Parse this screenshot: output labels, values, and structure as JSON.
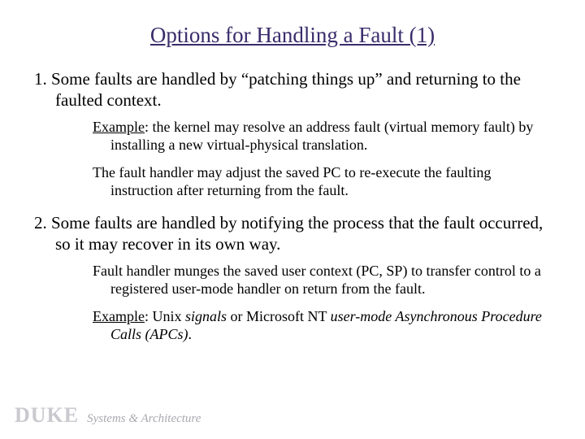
{
  "title": "Options for Handling a Fault (1)",
  "p1": "1. Some faults are handled by “patching things up” and returning to the faulted context.",
  "s1a_label": "Example",
  "s1a_rest": ": the kernel may resolve an address fault (virtual memory fault) by installing a new virtual-physical translation.",
  "s1b": "The fault handler may adjust the saved PC to re-execute the faulting instruction after returning from the fault.",
  "p2": "2. Some faults are handled by notifying the process that the fault occurred, so it may recover in its own way.",
  "s2a": "Fault handler munges the saved user context (PC, SP) to transfer control to a registered user-mode handler on return from the fault.",
  "s2b_label": "Example",
  "s2b_pre": ": Unix ",
  "s2b_sig": "signals",
  "s2b_mid": " or Microsoft NT ",
  "s2b_apc": "user-mode Asynchronous Procedure Calls (APCs)",
  "s2b_post": ".",
  "footer_duke": "DUKE",
  "footer_sys": "Systems & Architecture"
}
